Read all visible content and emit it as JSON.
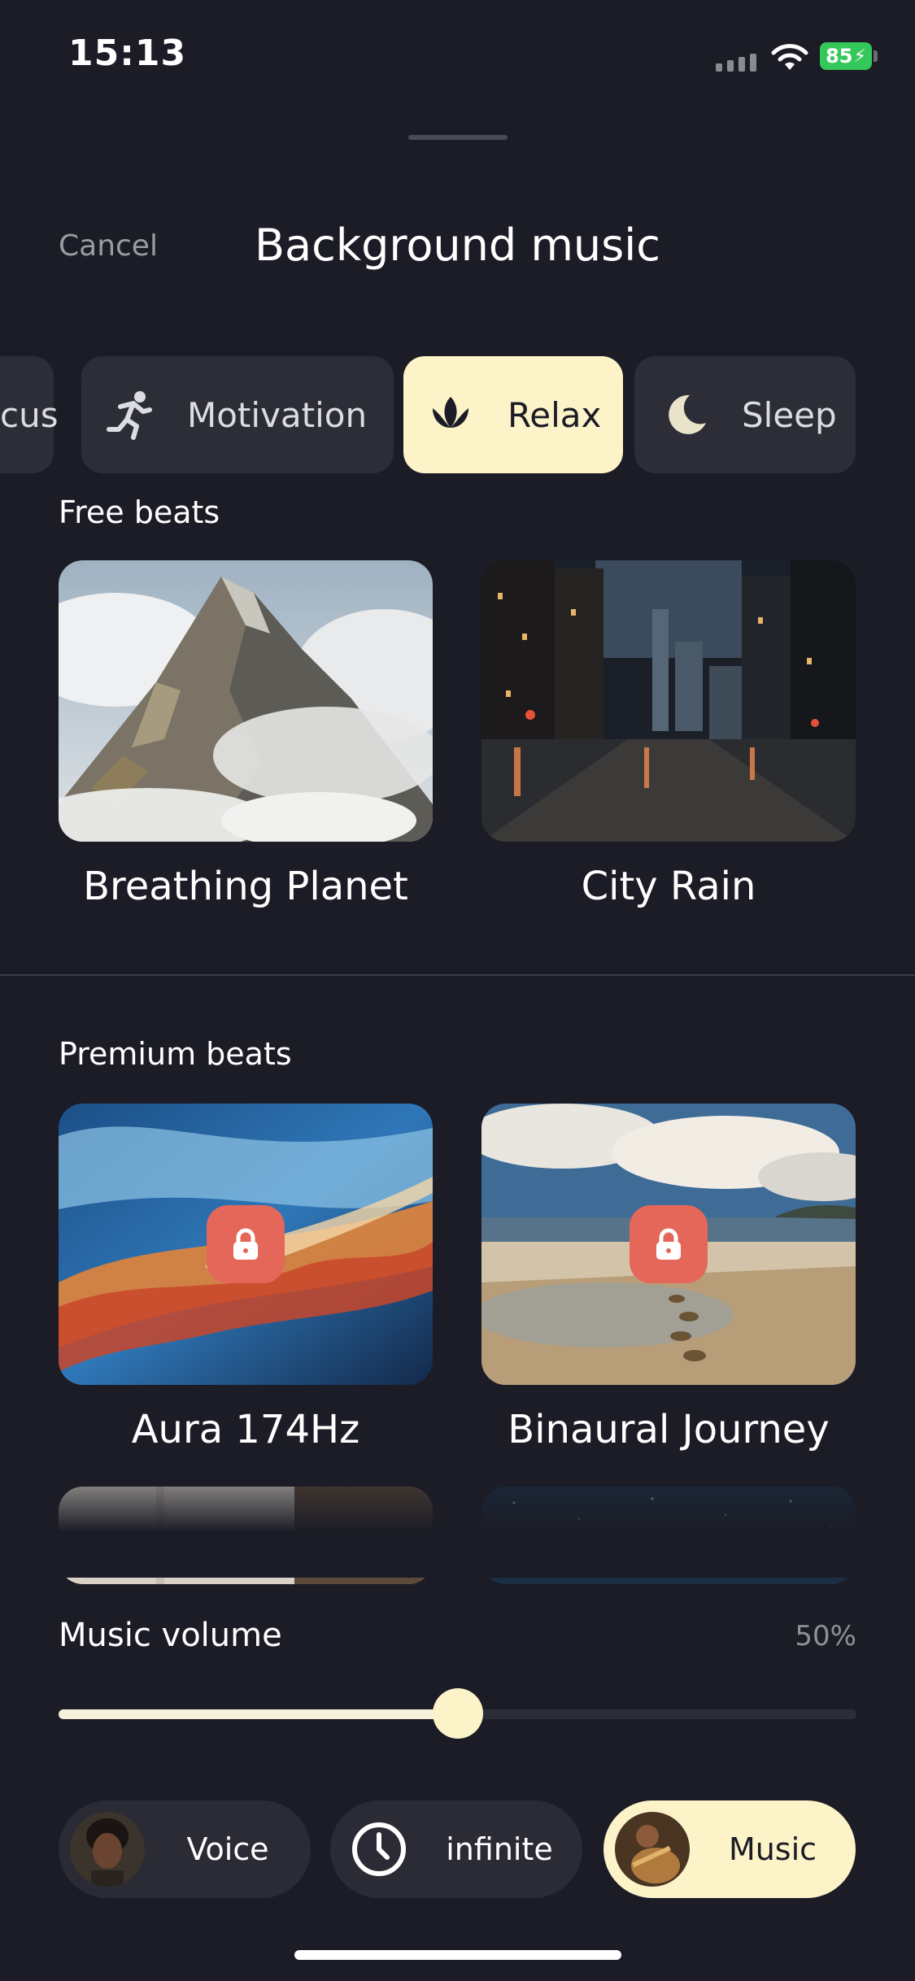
{
  "status": {
    "time": "15:13",
    "battery": "85"
  },
  "header": {
    "cancel_label": "Cancel",
    "title": "Background music"
  },
  "categories": [
    {
      "label": "cus",
      "icon": "focus-icon",
      "active": false
    },
    {
      "label": "Motivation",
      "icon": "running-person-icon",
      "active": false
    },
    {
      "label": "Relax",
      "icon": "lotus-icon",
      "active": true
    },
    {
      "label": "Sleep",
      "icon": "moon-icon",
      "active": false
    }
  ],
  "free": {
    "label": "Free beats",
    "items": [
      {
        "title": "Breathing Planet",
        "image": "misty-mountain-peak"
      },
      {
        "title": "City Rain",
        "image": "rainy-night-city-street"
      }
    ]
  },
  "premium": {
    "label": "Premium beats",
    "items": [
      {
        "title": "Aura 174Hz",
        "image": "swirling-blue-orange-abstract",
        "locked": true
      },
      {
        "title": "Binaural Journey",
        "image": "beach-footprints-sunset",
        "locked": true
      },
      {
        "title": "",
        "image": "warm-interior-partial",
        "locked": false
      },
      {
        "title": "",
        "image": "starry-night-partial",
        "locked": false
      }
    ]
  },
  "volume": {
    "label": "Music volume",
    "value_text": "50%",
    "value": 0.5
  },
  "bottom_bar": {
    "voice_label": "Voice",
    "duration_label": "infinite",
    "music_label": "Music"
  },
  "colors": {
    "background": "#1b1c26",
    "chip": "#2c2d37",
    "accent_cream": "#fdf3c9",
    "lock_red": "#e5675a",
    "battery_green": "#34c759"
  }
}
